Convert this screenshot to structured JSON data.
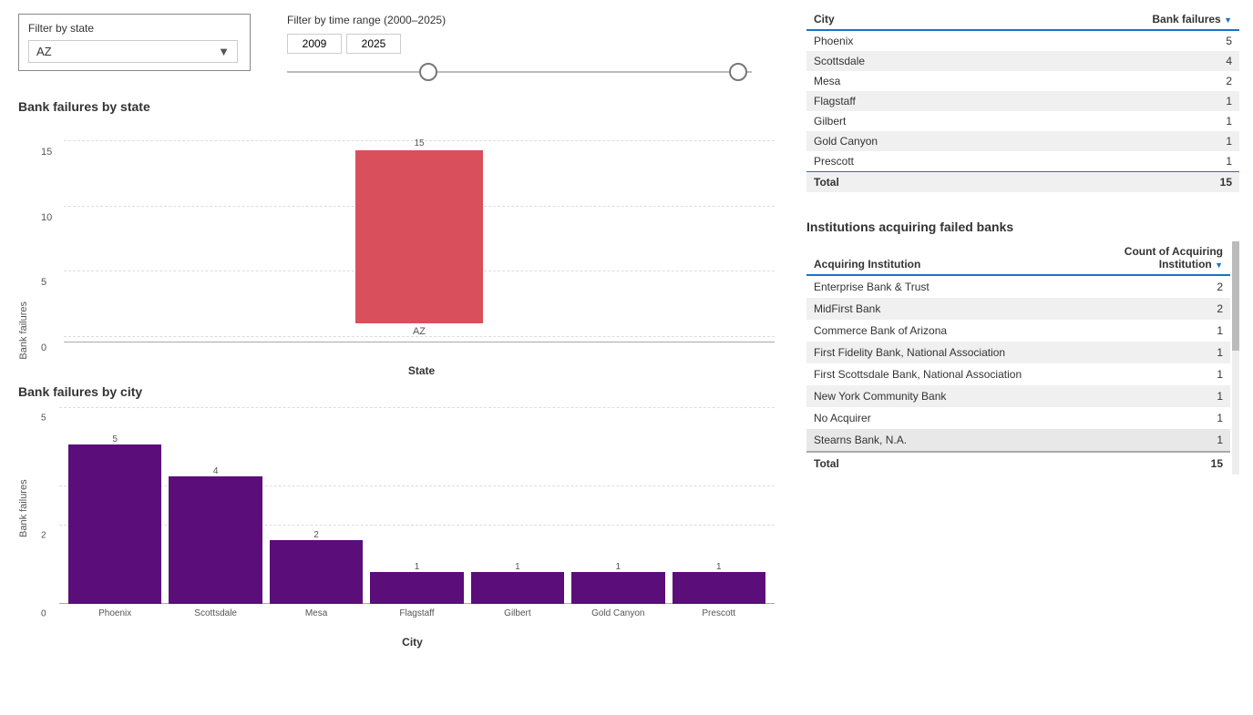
{
  "filters": {
    "state_label": "Filter by state",
    "state_value": "AZ",
    "time_label": "Filter by time range (2000–2025)",
    "time_start": "2009",
    "time_end": "2025"
  },
  "state_chart": {
    "title": "Bank failures by state",
    "y_label": "Bank failures",
    "x_label": "State",
    "bar_value": "15",
    "bar_x_label": "AZ",
    "y_ticks": [
      "0",
      "5",
      "10",
      "15"
    ],
    "bar_height_pct": 100
  },
  "city_chart": {
    "title": "Bank failures by city",
    "y_label": "Bank failures",
    "x_label": "City",
    "bars": [
      {
        "city": "Phoenix",
        "value": 5,
        "label": "5"
      },
      {
        "city": "Scottsdale",
        "value": 4,
        "label": "4"
      },
      {
        "city": "Mesa",
        "value": 2,
        "label": "2"
      },
      {
        "city": "Flagstaff",
        "value": 1,
        "label": "1"
      },
      {
        "city": "Gilbert",
        "value": 1,
        "label": "1"
      },
      {
        "city": "Gold Canyon",
        "value": 1,
        "label": "1"
      },
      {
        "city": "Prescott",
        "value": 1,
        "label": "1"
      }
    ]
  },
  "city_table": {
    "col1": "City",
    "col2": "Bank failures",
    "rows": [
      {
        "city": "Phoenix",
        "count": "5",
        "even": false
      },
      {
        "city": "Scottsdale",
        "count": "4",
        "even": true
      },
      {
        "city": "Mesa",
        "count": "2",
        "even": false
      },
      {
        "city": "Flagstaff",
        "count": "1",
        "even": true
      },
      {
        "city": "Gilbert",
        "count": "1",
        "even": false
      },
      {
        "city": "Gold Canyon",
        "count": "1",
        "even": true
      },
      {
        "city": "Prescott",
        "count": "1",
        "even": false
      }
    ],
    "total_label": "Total",
    "total_count": "15"
  },
  "institutions": {
    "title": "Institutions acquiring failed banks",
    "col1": "Acquiring Institution",
    "col2": "Count of Acquiring Institution",
    "rows": [
      {
        "name": "Enterprise Bank & Trust",
        "count": "2",
        "even": false
      },
      {
        "name": "MidFirst Bank",
        "count": "2",
        "even": true
      },
      {
        "name": "Commerce Bank of Arizona",
        "count": "1",
        "even": false
      },
      {
        "name": "First Fidelity Bank, National Association",
        "count": "1",
        "even": true
      },
      {
        "name": "First Scottsdale Bank, National Association",
        "count": "1",
        "even": false
      },
      {
        "name": "New York Community Bank",
        "count": "1",
        "even": true
      },
      {
        "name": "No Acquirer",
        "count": "1",
        "even": false
      },
      {
        "name": "Stearns Bank, N.A.",
        "count": "1",
        "even": true,
        "partial": true
      }
    ],
    "total_label": "Total",
    "total_count": "15"
  }
}
